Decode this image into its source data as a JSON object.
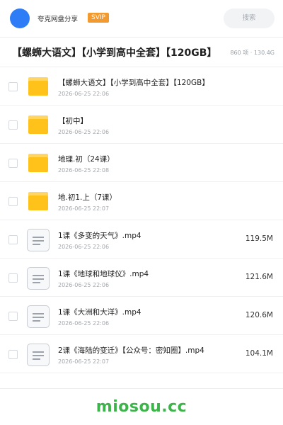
{
  "header": {
    "share_name": "夸克网盘分享",
    "badge": "SVIP",
    "search_placeholder": "搜索"
  },
  "title_bar": {
    "title": "【螺蛳大语文】【小学到高中全套】【120GB】",
    "meta": "860 项 · 130.4G"
  },
  "items": [
    {
      "type": "folder",
      "icon": "folder-icon",
      "name": "【螺蛳大语文】【小学到高中全套】【120GB】",
      "date": "2026-06-25 22:06",
      "size": ""
    },
    {
      "type": "folder",
      "icon": "folder-icon",
      "name": "【初中】",
      "date": "2026-06-25 22:06",
      "size": ""
    },
    {
      "type": "folder",
      "icon": "folder-icon",
      "name": "地理.初（24课）",
      "date": "2026-06-25 22:08",
      "size": ""
    },
    {
      "type": "folder",
      "icon": "folder-icon",
      "name": "地.初1.上（7课）",
      "date": "2026-06-25 22:07",
      "size": ""
    },
    {
      "type": "file",
      "icon": "file-icon",
      "name": "1课《多变的天气》.mp4",
      "date": "2026-06-25 22:06",
      "size": "119.5M"
    },
    {
      "type": "file",
      "icon": "file-icon",
      "name": "1课《地球和地球仪》.mp4",
      "date": "2026-06-25 22:06",
      "size": "121.6M"
    },
    {
      "type": "file",
      "icon": "file-icon",
      "name": "1课《大洲和大洋》.mp4",
      "date": "2026-06-25 22:06",
      "size": "120.6M"
    },
    {
      "type": "file",
      "icon": "file-icon",
      "name": "2课《海陆的变迁》【公众号：密知圈】.mp4",
      "date": "2026-06-25 22:07",
      "size": "104.1M"
    }
  ],
  "footer": {
    "watermark": "miosou.cc"
  },
  "colors": {
    "accent": "#2f7df6",
    "badge": "#f39a2e",
    "folder": "#ffc21a",
    "watermark": "#3bb54a"
  }
}
